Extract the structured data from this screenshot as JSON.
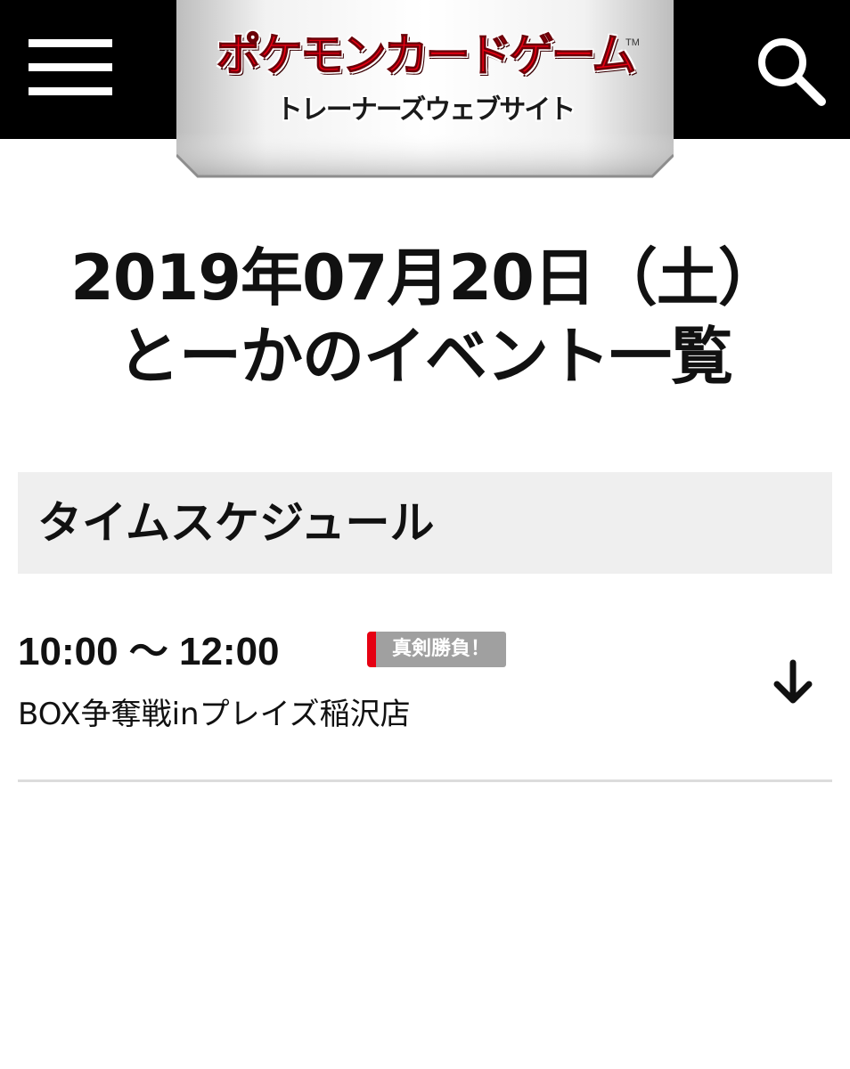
{
  "header": {
    "menu_icon": "hamburger-menu-icon",
    "search_icon": "search-icon",
    "logo": {
      "title": "ポケモンカードゲーム",
      "subtitle": "トレーナーズウェブサイト",
      "trademark": "TM"
    },
    "colors": {
      "bar": "#000000",
      "logo_red": "#e60012",
      "plate": "#d9d9d9"
    }
  },
  "page": {
    "title_line1": "2019年07月20日（土）",
    "title_line2": "とーかのイベント一覧"
  },
  "schedule": {
    "section_label": "タイムスケジュール",
    "events": [
      {
        "time": "10:00 〜 12:00",
        "badge": "真剣勝負！",
        "badge_color": "#e60012",
        "name": "BOX争奪戦inプレイズ稲沢店",
        "expand_icon": "arrow-down-icon"
      }
    ]
  }
}
